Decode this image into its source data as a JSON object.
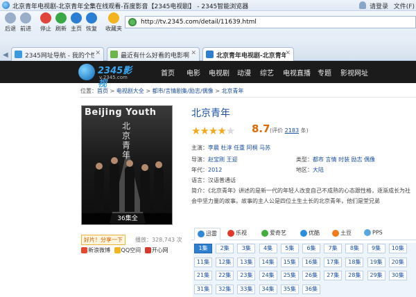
{
  "window": {
    "title": "北京青年电视剧-北京青年全集在线观看-百度影音【2345电视剧】 - 2345智能浏览器",
    "login": "请登录",
    "file_menu": "文件(F)"
  },
  "toolbar": {
    "buttons": [
      {
        "label": "后退",
        "icon": "back-icon",
        "color": "#9aaec9"
      },
      {
        "label": "前进",
        "icon": "forward-icon",
        "color": "#9aaec9"
      },
      {
        "label": "停止",
        "icon": "stop-icon",
        "color": "#e0453b"
      },
      {
        "label": "刷新",
        "icon": "refresh-icon",
        "color": "#3aa845"
      },
      {
        "label": "主页",
        "icon": "home-icon",
        "color": "#2a7fd4"
      },
      {
        "label": "恢复",
        "icon": "restore-icon",
        "color": "#2a7fd4"
      },
      {
        "label": "收藏夹",
        "icon": "favorites-icon",
        "color": "#f2b51f"
      }
    ],
    "url": "http://tv.2345.com/detail/11639.html"
  },
  "tabs": [
    {
      "label": "2345网址导航 - 我的个性...",
      "color": "#3a9be0"
    },
    {
      "label": "最近有什么好看的电影啊...",
      "color": "#6cb54a"
    },
    {
      "label": "北京青年电视剧-北京青年...",
      "color": "#2f7fd1"
    }
  ],
  "site": {
    "brand": "2345影视",
    "domain": "v.2345.com",
    "nav": [
      "首页",
      "电影",
      "电视剧",
      "动漫",
      "综艺",
      "电视直播",
      "专题",
      "影视网址"
    ]
  },
  "breadcrumb": {
    "prefix": "位置：",
    "items": [
      "首页",
      "电视剧大全",
      "都市/言情剧集/励志/偶像",
      "北京青年"
    ],
    "sep": " > "
  },
  "poster": {
    "title": "Beijing Youth",
    "vertical_title": "北京青年",
    "episodes": "36集全"
  },
  "share": {
    "button": "好片！分享一下",
    "plays": "播放：328,743 次",
    "targets": [
      "新浪微博",
      "QQ空间",
      "开心网"
    ]
  },
  "show": {
    "title": "北京青年",
    "score": "8.7",
    "rating_prefix": "(评价 ",
    "rating_count": "2183",
    "rating_suffix": " 条)",
    "stars": 4.5,
    "starring_label": "主演：",
    "starring": "李晨  杜淳  任重  阿桐  马苏",
    "director_label": "导演：",
    "director": "赵宝刚 王迎",
    "type_label": "类型：",
    "type": "都市 言情 时装 励志 偶像",
    "year_label": "年代：",
    "year": "2012",
    "region_label": "地区：",
    "region": "大陆",
    "language_label": "语言：",
    "language": "汉语普通话",
    "summary_label": "简介：",
    "summary": "《北京青年》讲述的是新一代的年轻人改变自己不成熟的心态跟性格，逐渐成长为社会中坚力量的故事。故事的主人公是四位土生土长的北京青年，他们是堂兄弟"
  },
  "sources": [
    {
      "label": "迅雷",
      "color": "#2f88d8"
    },
    {
      "label": "乐视",
      "color": "#e23a2a"
    },
    {
      "label": "爱奇艺",
      "color": "#3fae3a"
    },
    {
      "label": "优酷",
      "color": "#2a8ee0"
    },
    {
      "label": "土豆",
      "color": "#f07a1a"
    },
    {
      "label": "PPS",
      "color": "#5aa7e0"
    }
  ],
  "episodes": [
    "1集",
    "2集",
    "3集",
    "4集",
    "5集",
    "6集",
    "7集",
    "8集",
    "9集",
    "10集",
    "11集",
    "12集",
    "13集",
    "14集",
    "15集",
    "16集",
    "17集",
    "18集",
    "19集",
    "20集",
    "21集",
    "22集",
    "23集",
    "24集",
    "25集",
    "26集",
    "27集",
    "28集",
    "29集",
    "30集",
    "31集",
    "32集",
    "33集",
    "34集",
    "35集",
    "36集"
  ]
}
